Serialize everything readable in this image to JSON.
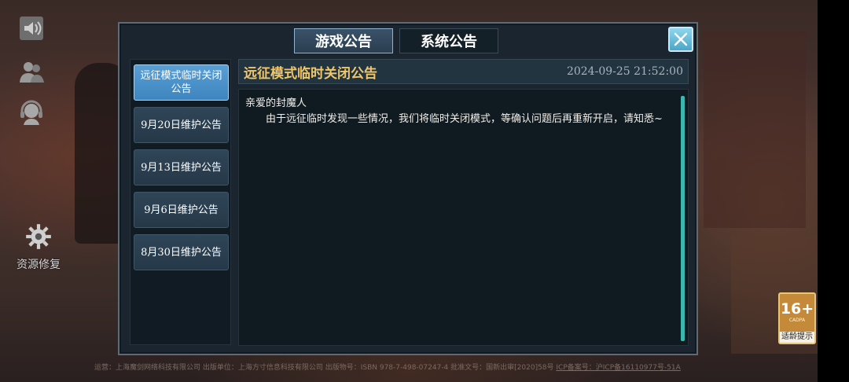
{
  "side": {
    "repair_label": "资源修复"
  },
  "tabs": [
    {
      "label": "游戏公告",
      "active": true
    },
    {
      "label": "系统公告",
      "active": false
    }
  ],
  "announcements": [
    {
      "label": "远征模式临时关闭公告",
      "active": true
    },
    {
      "label": "9月20日维护公告",
      "active": false
    },
    {
      "label": "9月13日维护公告",
      "active": false
    },
    {
      "label": "9月6日维护公告",
      "active": false
    },
    {
      "label": "8月30日维护公告",
      "active": false
    }
  ],
  "detail": {
    "title": "远征模式临时关闭公告",
    "datetime": "2024-09-25  21:52:00",
    "greeting": "亲爱的封魔人",
    "body": "由于远征临时发现一些情况，我们将临时关闭模式，等确认问题后再重新开启，请知悉~"
  },
  "footer": {
    "publisher": "运营：上海魔剑网络科技有限公司 出版单位：上海方寸信息科技有限公司 出版物号：ISBN 978-7-498-07247-4 批准文号：国新出审[2020]58号",
    "icp": "ICP备案号：沪ICP备16110977号-51A"
  },
  "age_rating": {
    "value": "16+",
    "org": "CADPA",
    "tip": "适龄提示"
  },
  "colors": {
    "title_gold": "#f1c66a",
    "active_item": "#4a90c8",
    "scrollbar": "#3bb7b1"
  }
}
